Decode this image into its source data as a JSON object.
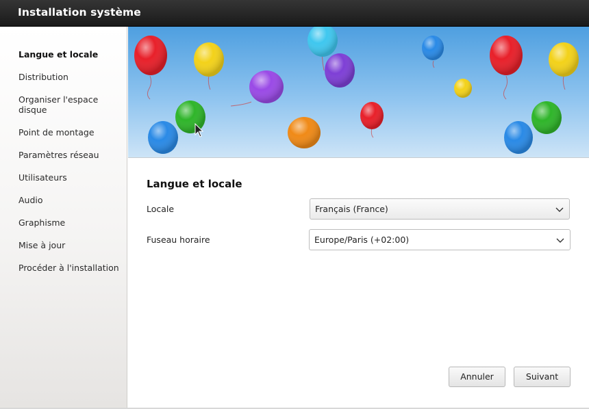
{
  "window": {
    "title": "Installation système"
  },
  "sidebar": {
    "items": [
      {
        "label": "Langue et locale",
        "active": true
      },
      {
        "label": "Distribution",
        "active": false
      },
      {
        "label": "Organiser l'espace disque",
        "active": false
      },
      {
        "label": "Point de montage",
        "active": false
      },
      {
        "label": "Paramètres réseau",
        "active": false
      },
      {
        "label": "Utilisateurs",
        "active": false
      },
      {
        "label": "Audio",
        "active": false
      },
      {
        "label": "Graphisme",
        "active": false
      },
      {
        "label": "Mise à jour",
        "active": false
      },
      {
        "label": "Procéder à l'installation",
        "active": false
      }
    ]
  },
  "banner": {
    "image": "colorful-balloons",
    "colors": [
      "#e8202a",
      "#f3d21a",
      "#3fc7ef",
      "#8a3fd6",
      "#2a8ae6",
      "#2fb52a",
      "#f08a17"
    ]
  },
  "main": {
    "section_title": "Langue et locale",
    "locale": {
      "label": "Locale",
      "value": "Français (France)"
    },
    "timezone": {
      "label": "Fuseau horaire",
      "value": "Europe/Paris (+02:00)"
    }
  },
  "buttons": {
    "cancel": "Annuler",
    "next": "Suivant"
  }
}
